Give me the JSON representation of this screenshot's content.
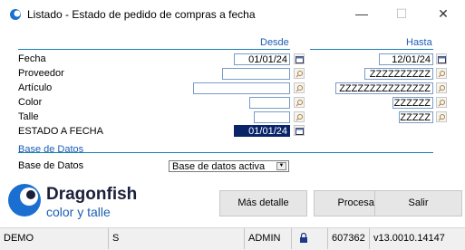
{
  "window": {
    "title": "Listado - Estado de pedido de compras a fecha",
    "minimize": "—",
    "maximize": "☐",
    "close": "✕"
  },
  "headers": {
    "desde": "Desde",
    "hasta": "Hasta"
  },
  "rows": {
    "fecha": {
      "label": "Fecha",
      "desde": "01/01/24",
      "hasta": "12/01/24"
    },
    "proveedor": {
      "label": "Proveedor",
      "desde": "",
      "hasta": "ZZZZZZZZZZ"
    },
    "articulo": {
      "label": "Artículo",
      "desde": "",
      "hasta": "ZZZZZZZZZZZZZZZ"
    },
    "color": {
      "label": "Color",
      "desde": "",
      "hasta": "ZZZZZZ"
    },
    "talle": {
      "label": "Talle",
      "desde": "",
      "hasta": "ZZZZZ"
    },
    "estado": {
      "label": "ESTADO A FECHA",
      "value": "01/01/24"
    }
  },
  "database": {
    "section": "Base de Datos",
    "label": "Base de Datos",
    "value": "Base de datos activa"
  },
  "logo": {
    "name": "Dragonfish",
    "tagline": "color y talle"
  },
  "buttons": {
    "detail": "Más detalle",
    "process": "Procesar",
    "exit": "Salir"
  },
  "status": {
    "mode": "DEMO",
    "flag": "S",
    "user": "ADMIN",
    "code": "607362",
    "version": "v13.0010.14147"
  },
  "colors": {
    "accent": "#1a5fb4",
    "selection": "#0a246a"
  }
}
